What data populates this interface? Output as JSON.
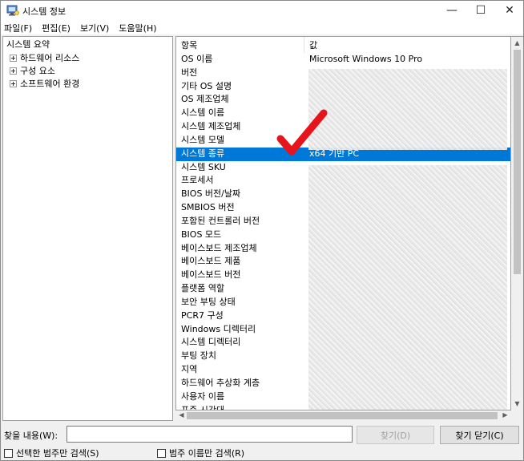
{
  "window": {
    "title": "시스템 정보",
    "minimize_glyph": "—",
    "maximize_glyph": "☐",
    "close_glyph": "✕"
  },
  "menu": [
    "파일(F)",
    "편집(E)",
    "보기(V)",
    "도움말(H)"
  ],
  "tree": {
    "root": "시스템 요약",
    "children": [
      "하드웨어 리소스",
      "구성 요소",
      "소프트웨어 환경"
    ]
  },
  "list": {
    "col_item": "항목",
    "col_value": "값",
    "rows": [
      {
        "item": "OS 이름",
        "value": "Microsoft Windows 10 Pro"
      },
      {
        "item": "버전",
        "value": ""
      },
      {
        "item": "기타 OS 설명",
        "value": ""
      },
      {
        "item": "OS 제조업체",
        "value": ""
      },
      {
        "item": "시스템 이름",
        "value": ""
      },
      {
        "item": "시스템 제조업체",
        "value": ""
      },
      {
        "item": "시스템 모델",
        "value": ""
      },
      {
        "item": "시스템 종류",
        "value": "x64 기반 PC",
        "selected": true
      },
      {
        "item": "시스템 SKU",
        "value": ""
      },
      {
        "item": "프로세서",
        "value": ""
      },
      {
        "item": "BIOS 버전/날짜",
        "value": ""
      },
      {
        "item": "SMBIOS 버전",
        "value": ""
      },
      {
        "item": "포함된 컨트롤러 버전",
        "value": ""
      },
      {
        "item": "BIOS 모드",
        "value": ""
      },
      {
        "item": "베이스보드 제조업체",
        "value": ""
      },
      {
        "item": "베이스보드 제품",
        "value": ""
      },
      {
        "item": "베이스보드 버전",
        "value": ""
      },
      {
        "item": "플랫폼 역할",
        "value": ""
      },
      {
        "item": "보안 부팅 상태",
        "value": ""
      },
      {
        "item": "PCR7 구성",
        "value": ""
      },
      {
        "item": "Windows 디렉터리",
        "value": ""
      },
      {
        "item": "시스템 디렉터리",
        "value": ""
      },
      {
        "item": "부팅 장치",
        "value": ""
      },
      {
        "item": "지역",
        "value": ""
      },
      {
        "item": "하드웨어 추상화 계층",
        "value": ""
      },
      {
        "item": "사용자 이름",
        "value": ""
      },
      {
        "item": "표준 시간대",
        "value": ""
      }
    ]
  },
  "find": {
    "label": "찾을 내용(W):",
    "input_value": "",
    "find_button": "찾기(D)",
    "close_find_button": "찾기 닫기(C)",
    "check_selected_only": "선택한 범주만 검색(S)",
    "check_category_names": "범주 이름만 검색(R)"
  },
  "colors": {
    "selection": "#0078d7",
    "annotation_check": "#e8141c"
  },
  "icons": {
    "app": "system-info-icon",
    "annotation": "red-checkmark-icon"
  }
}
